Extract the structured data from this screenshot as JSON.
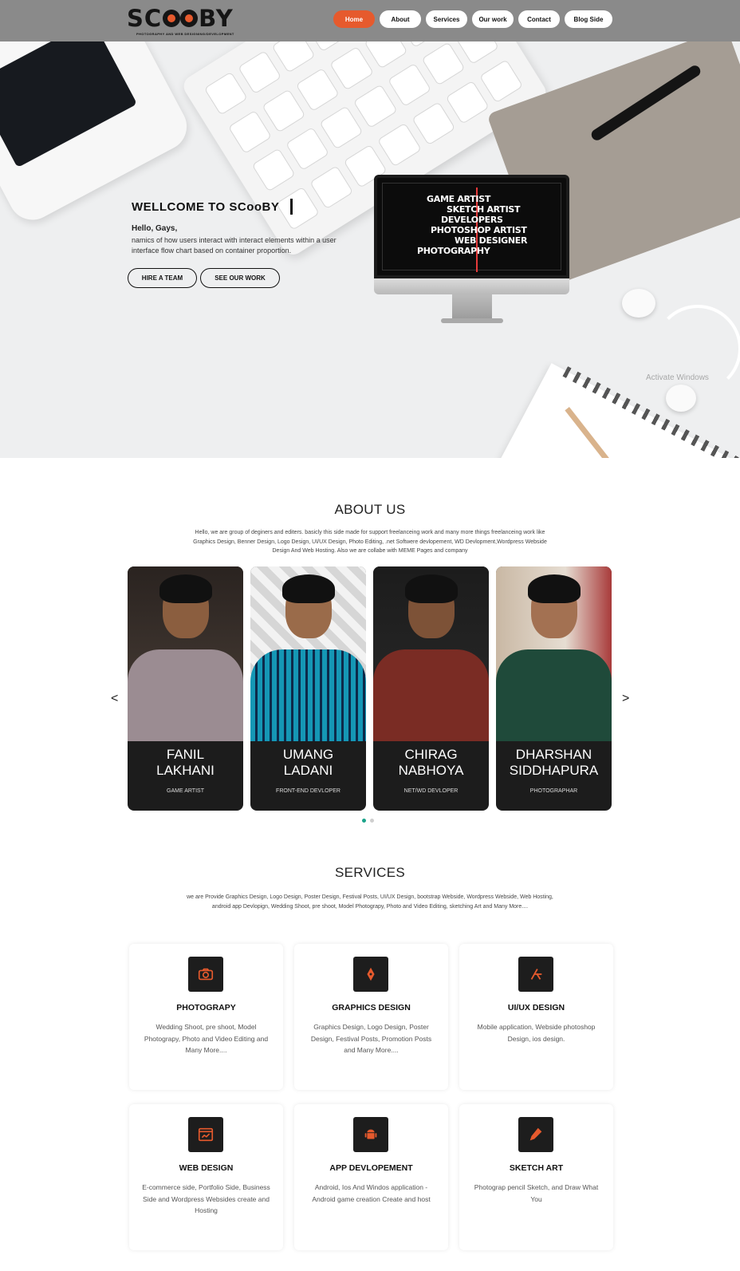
{
  "nav": {
    "logo_prefix": "SC",
    "logo_suffix": "BY",
    "logo_tagline": "PHOTOGRAPHY AND WEB DESIGNING/DEVELOPMENT",
    "items": [
      {
        "label": "Home",
        "active": true
      },
      {
        "label": "About",
        "active": false
      },
      {
        "label": "Services",
        "active": false
      },
      {
        "label": "Our work",
        "active": false
      },
      {
        "label": "Contact",
        "active": false
      },
      {
        "label": "Blog Side",
        "active": false
      }
    ]
  },
  "hero": {
    "title": "WELLCOME TO SCooBY",
    "hello": "Hello, Gays,",
    "description": "namics of how users interact with interact elements within a user interface flow chart based on container proportion.",
    "buttons": {
      "hire": "HIRE A TEAM",
      "work": "SEE OUR WORK"
    },
    "monitor_lines": [
      "GAME ARTIST",
      "SKETCH ARTIST",
      "DEVELOPERS",
      "PHOTOSHOP ARTIST",
      "WEB DESIGNER",
      "PHOTOGRAPHY"
    ],
    "watermark": "Activate Windows"
  },
  "about": {
    "title": "ABOUT US",
    "description": "Hello, we are group of deginers and editers. basicly this side made for support freelanceing work and many more things freelanceing work like Graphics Design, Benner Design, Logo Design, UI/UX Design, Photo Editing, .net Softwere devlopement, WD Devlopment,Wordpress Webside Design And Web Hosting. Also we are collabe with MEME Pages and company",
    "prev_arrow": "<",
    "next_arrow": ">",
    "team": [
      {
        "first": "FANIL",
        "last": "LAKHANI",
        "role": "GAME ARTIST"
      },
      {
        "first": "UMANG",
        "last": "LADANI",
        "role": "FRONT-END DEVLOPER"
      },
      {
        "first": "CHIRAG",
        "last": "NABHOYA",
        "role": "NET/WD DEVLOPER"
      },
      {
        "first": "DHARSHAN",
        "last": "SIDDHAPURA",
        "role": "PHOTOGRAPHAR"
      }
    ]
  },
  "services": {
    "title": "SERVICES",
    "description": "we are Provide Graphics Design, Logo Design, Poster Design, Festival Posts, UI/UX Design, bootstrap Webside, Wordpress Webside, Web Hosting, android app Devlopign, Wedding Shoot, pre shoot, Model Photograpy, Photo and Video Editing, sketching Art and Many More....",
    "items": [
      {
        "icon": "camera-icon",
        "title": "PHOTOGRAPY",
        "desc": "Wedding Shoot, pre shoot, Model Photograpy, Photo and Video Editing and Many More...."
      },
      {
        "icon": "pen-tool-icon",
        "title": "GRAPHICS DESIGN",
        "desc": "Graphics Design, Logo Design, Poster Design, Festival Posts, Promotion Posts and Many More...."
      },
      {
        "icon": "app-store-icon",
        "title": "UI/UX DESIGN",
        "desc": "Mobile application, Webside photoshop Design, ios design."
      },
      {
        "icon": "browser-window-icon",
        "title": "WEB DESIGN",
        "desc": "E-commerce side, Portfolio Side, Business Side and Wordpress Websides create and Hosting"
      },
      {
        "icon": "android-icon",
        "title": "APP DEVLOPEMENT",
        "desc": "Android, Ios And Windos application - Android game creation Create and host"
      },
      {
        "icon": "pencil-icon",
        "title": "SKETCH ART",
        "desc": "Photograp pencil Sketch, and Draw What You"
      }
    ]
  },
  "colors": {
    "accent": "#e65a2d",
    "nav_bg": "#8a8a8a",
    "card_bg": "#1c1c1c",
    "dot_active": "#1aa38a"
  }
}
